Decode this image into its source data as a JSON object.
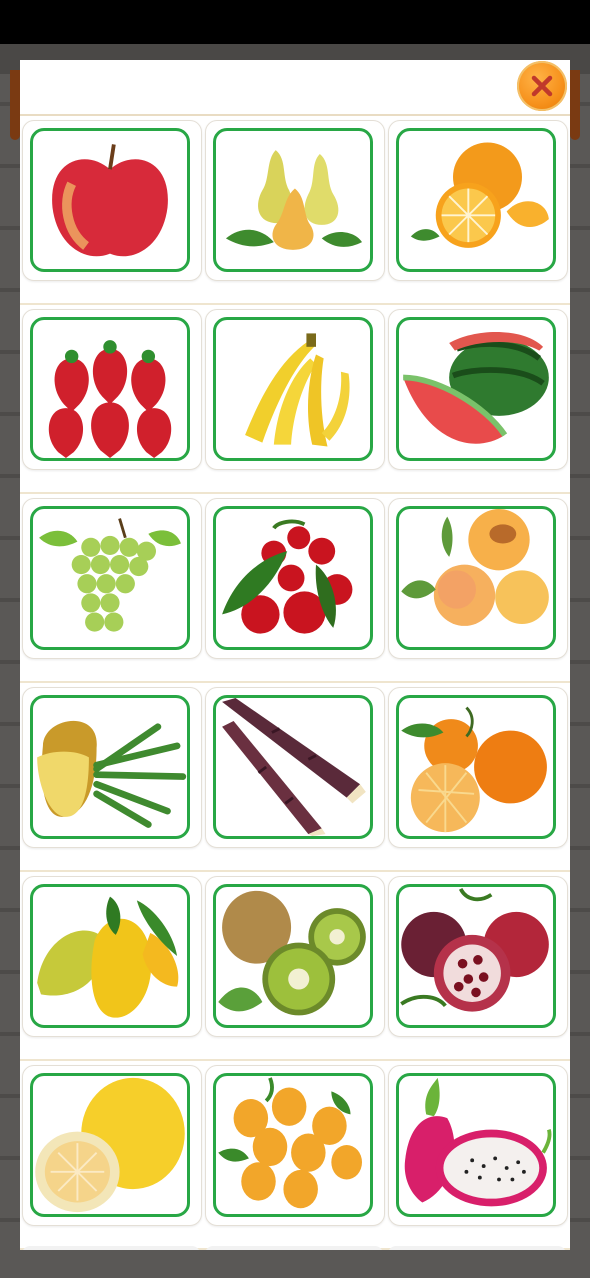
{
  "dialog": {
    "close_icon": "close-x-icon",
    "accent_color": "#f7931e",
    "card_border_color": "#28a745"
  },
  "fruits": [
    {
      "name": "apple",
      "icon": "apple-icon"
    },
    {
      "name": "pear",
      "icon": "pear-icon"
    },
    {
      "name": "orange",
      "icon": "orange-icon"
    },
    {
      "name": "strawberry",
      "icon": "strawberry-icon"
    },
    {
      "name": "banana",
      "icon": "banana-icon"
    },
    {
      "name": "watermelon",
      "icon": "watermelon-icon"
    },
    {
      "name": "grape",
      "icon": "grape-icon"
    },
    {
      "name": "cherry",
      "icon": "cherry-icon"
    },
    {
      "name": "peach",
      "icon": "peach-icon"
    },
    {
      "name": "pineapple",
      "icon": "pineapple-icon"
    },
    {
      "name": "sugarcane",
      "icon": "sugarcane-icon"
    },
    {
      "name": "tangerine",
      "icon": "tangerine-icon"
    },
    {
      "name": "mango",
      "icon": "mango-icon"
    },
    {
      "name": "kiwi",
      "icon": "kiwi-icon"
    },
    {
      "name": "pomegranate",
      "icon": "pomegranate-icon"
    },
    {
      "name": "pomelo",
      "icon": "pomelo-icon"
    },
    {
      "name": "loquat",
      "icon": "loquat-icon"
    },
    {
      "name": "dragon-fruit",
      "icon": "dragon-fruit-icon"
    }
  ]
}
